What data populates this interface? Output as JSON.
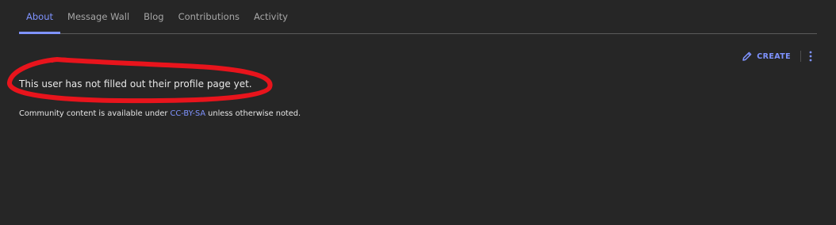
{
  "tabs": [
    {
      "label": "About",
      "active": true
    },
    {
      "label": "Message Wall",
      "active": false
    },
    {
      "label": "Blog",
      "active": false
    },
    {
      "label": "Contributions",
      "active": false
    },
    {
      "label": "Activity",
      "active": false
    }
  ],
  "actions": {
    "create_label": "CREATE",
    "create_icon": "pencil-icon",
    "more_icon": "kebab-menu-icon"
  },
  "content": {
    "profile_message": "This user has not filled out their profile page yet."
  },
  "license": {
    "prefix": "Community content is available under ",
    "link_text": "CC-BY-SA",
    "suffix": " unless otherwise noted."
  },
  "colors": {
    "background": "#262626",
    "accent": "#7f93ff",
    "annotation": "#e8141c"
  }
}
